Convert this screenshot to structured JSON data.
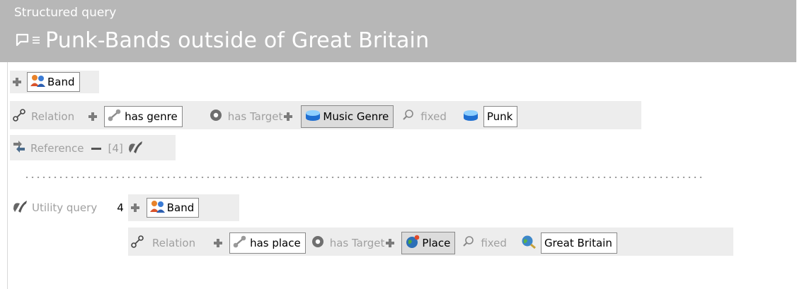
{
  "header": {
    "subtitle": "Structured query",
    "title": "Punk-Bands outside of Great Britain",
    "bg_color": "#b7b7b7",
    "icons": [
      "speech-bubble-icon",
      "menu-lines-icon"
    ]
  },
  "query": {
    "root_concept": "Band",
    "relation1": {
      "label": "Relation",
      "predicate": "has genre",
      "target_label": "has Target",
      "target_class": "Music Genre",
      "fixed_label": "fixed",
      "fixed_value": "Punk"
    },
    "reference": {
      "label": "Reference",
      "value": "[4]"
    },
    "utility": {
      "label": "Utility query",
      "index": "4",
      "concept": "Band",
      "relation": {
        "label": "Relation",
        "predicate": "has place",
        "target_label": "has Target",
        "target_class": "Place",
        "fixed_label": "fixed",
        "fixed_value": "Great Britain"
      }
    }
  }
}
